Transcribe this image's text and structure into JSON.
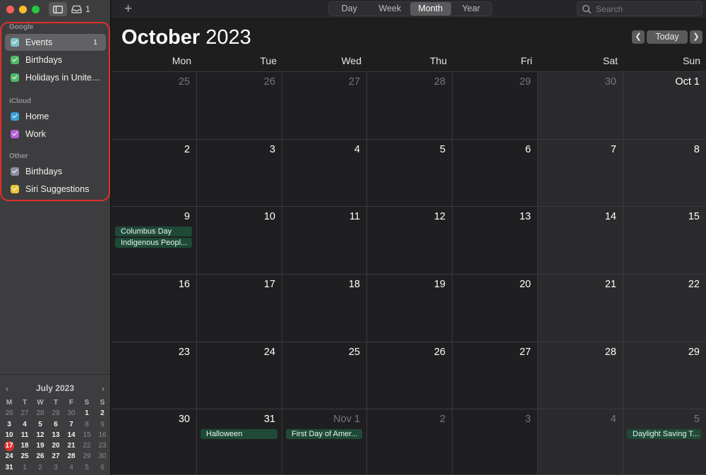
{
  "window": {
    "inbox_count": "1"
  },
  "sidebar": {
    "groups": [
      {
        "label": "Google",
        "items": [
          {
            "label": "Events",
            "color": "#7fc4c9",
            "badge": "1",
            "selected": true
          },
          {
            "label": "Birthdays",
            "color": "#4fb86a"
          },
          {
            "label": "Holidays in United...",
            "color": "#4fb86a"
          }
        ]
      },
      {
        "label": "iCloud",
        "items": [
          {
            "label": "Home",
            "color": "#3aa0d8"
          },
          {
            "label": "Work",
            "color": "#b35fd6"
          }
        ]
      },
      {
        "label": "Other",
        "items": [
          {
            "label": "Birthdays",
            "color": "#8a8fa3"
          },
          {
            "label": "Siri Suggestions",
            "color": "#e8c53a"
          }
        ]
      }
    ]
  },
  "mini_calendar": {
    "title": "July 2023",
    "headers": [
      "M",
      "T",
      "W",
      "T",
      "F",
      "S",
      "S"
    ],
    "weeks": [
      [
        [
          "26",
          true
        ],
        [
          "27",
          true
        ],
        [
          "28",
          true
        ],
        [
          "29",
          true
        ],
        [
          "30",
          true
        ],
        [
          "1",
          false
        ],
        [
          "2",
          false
        ]
      ],
      [
        [
          "3",
          false
        ],
        [
          "4",
          false
        ],
        [
          "5",
          false
        ],
        [
          "6",
          false
        ],
        [
          "7",
          false
        ],
        [
          "8",
          true
        ],
        [
          "9",
          true
        ]
      ],
      [
        [
          "10",
          false
        ],
        [
          "11",
          false
        ],
        [
          "12",
          false
        ],
        [
          "13",
          false
        ],
        [
          "14",
          false
        ],
        [
          "15",
          true
        ],
        [
          "16",
          true
        ]
      ],
      [
        [
          "17",
          false
        ],
        [
          "18",
          false
        ],
        [
          "19",
          false
        ],
        [
          "20",
          false
        ],
        [
          "21",
          false
        ],
        [
          "22",
          true
        ],
        [
          "23",
          true
        ]
      ],
      [
        [
          "24",
          false
        ],
        [
          "25",
          false
        ],
        [
          "26",
          false
        ],
        [
          "27",
          false
        ],
        [
          "28",
          false
        ],
        [
          "29",
          true
        ],
        [
          "30",
          true
        ]
      ],
      [
        [
          "31",
          false
        ],
        [
          "1",
          true
        ],
        [
          "2",
          true
        ],
        [
          "3",
          true
        ],
        [
          "4",
          true
        ],
        [
          "5",
          true
        ],
        [
          "6",
          true
        ]
      ]
    ],
    "today": "17"
  },
  "toolbar": {
    "views": [
      "Day",
      "Week",
      "Month",
      "Year"
    ],
    "active_view": "Month",
    "search_placeholder": "Search"
  },
  "header": {
    "month": "October",
    "year": "2023",
    "today_label": "Today"
  },
  "weekdays": [
    "Mon",
    "Tue",
    "Wed",
    "Thu",
    "Fri",
    "Sat",
    "Sun"
  ],
  "weeks": [
    [
      {
        "d": "25",
        "dim": true
      },
      {
        "d": "26",
        "dim": true
      },
      {
        "d": "27",
        "dim": true
      },
      {
        "d": "28",
        "dim": true
      },
      {
        "d": "29",
        "dim": true
      },
      {
        "d": "30",
        "dim": true
      },
      {
        "d": "Oct 1"
      }
    ],
    [
      {
        "d": "2"
      },
      {
        "d": "3"
      },
      {
        "d": "4"
      },
      {
        "d": "5"
      },
      {
        "d": "6"
      },
      {
        "d": "7"
      },
      {
        "d": "8"
      }
    ],
    [
      {
        "d": "9",
        "events": [
          "Columbus Day",
          "Indigenous Peopl..."
        ]
      },
      {
        "d": "10"
      },
      {
        "d": "11"
      },
      {
        "d": "12"
      },
      {
        "d": "13"
      },
      {
        "d": "14"
      },
      {
        "d": "15"
      }
    ],
    [
      {
        "d": "16"
      },
      {
        "d": "17"
      },
      {
        "d": "18"
      },
      {
        "d": "19"
      },
      {
        "d": "20"
      },
      {
        "d": "21"
      },
      {
        "d": "22"
      }
    ],
    [
      {
        "d": "23"
      },
      {
        "d": "24"
      },
      {
        "d": "25"
      },
      {
        "d": "26"
      },
      {
        "d": "27"
      },
      {
        "d": "28"
      },
      {
        "d": "29"
      }
    ],
    [
      {
        "d": "30"
      },
      {
        "d": "31",
        "events": [
          "Halloween"
        ]
      },
      {
        "d": "Nov 1",
        "dim": true,
        "events": [
          "First Day of Amer..."
        ]
      },
      {
        "d": "2",
        "dim": true
      },
      {
        "d": "3",
        "dim": true
      },
      {
        "d": "4",
        "dim": true
      },
      {
        "d": "5",
        "dim": true,
        "events": [
          "Daylight Saving T..."
        ]
      }
    ]
  ]
}
